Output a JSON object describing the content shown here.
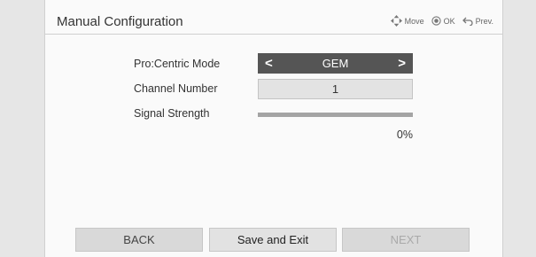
{
  "header": {
    "title": "Manual Configuration",
    "hints": {
      "move_label": "Move",
      "ok_label": "OK",
      "prev_label": "Prev."
    }
  },
  "form": {
    "mode_label": "Pro:Centric Mode",
    "mode_value": "GEM",
    "channel_label": "Channel Number",
    "channel_value": "1",
    "signal_label": "Signal Strength",
    "signal_value": "0%",
    "signal_fraction": 0
  },
  "footer": {
    "back_label": "BACK",
    "save_label": "Save and Exit",
    "next_label": "NEXT"
  }
}
